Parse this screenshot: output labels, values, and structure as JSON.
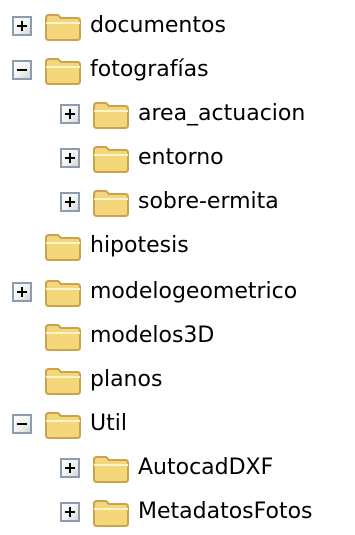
{
  "tree": {
    "items": [
      {
        "label": "documentos",
        "expander": "plus",
        "level": 0
      },
      {
        "label": "fotografías",
        "expander": "minus",
        "level": 0
      },
      {
        "label": "area_actuacion",
        "expander": "plus",
        "level": 1
      },
      {
        "label": "entorno",
        "expander": "plus",
        "level": 1
      },
      {
        "label": "sobre-ermita",
        "expander": "plus",
        "level": 1
      },
      {
        "label": "hipotesis",
        "expander": "none",
        "level": 0
      },
      {
        "label": "modelogeometrico",
        "expander": "plus",
        "level": 0
      },
      {
        "label": "modelos3D",
        "expander": "none",
        "level": 0
      },
      {
        "label": "planos",
        "expander": "none",
        "level": 0
      },
      {
        "label": "Util",
        "expander": "minus",
        "level": 0
      },
      {
        "label": "AutocadDXF",
        "expander": "plus",
        "level": 1
      },
      {
        "label": "MetadatosFotos",
        "expander": "plus",
        "level": 1
      }
    ]
  },
  "icons": {
    "folder": "folder-icon",
    "expand": "expand-icon",
    "collapse": "collapse-icon"
  },
  "colors": {
    "folder_fill": "#f4d77b",
    "folder_border": "#c9a24b",
    "expander_border": "#8f9cad"
  }
}
